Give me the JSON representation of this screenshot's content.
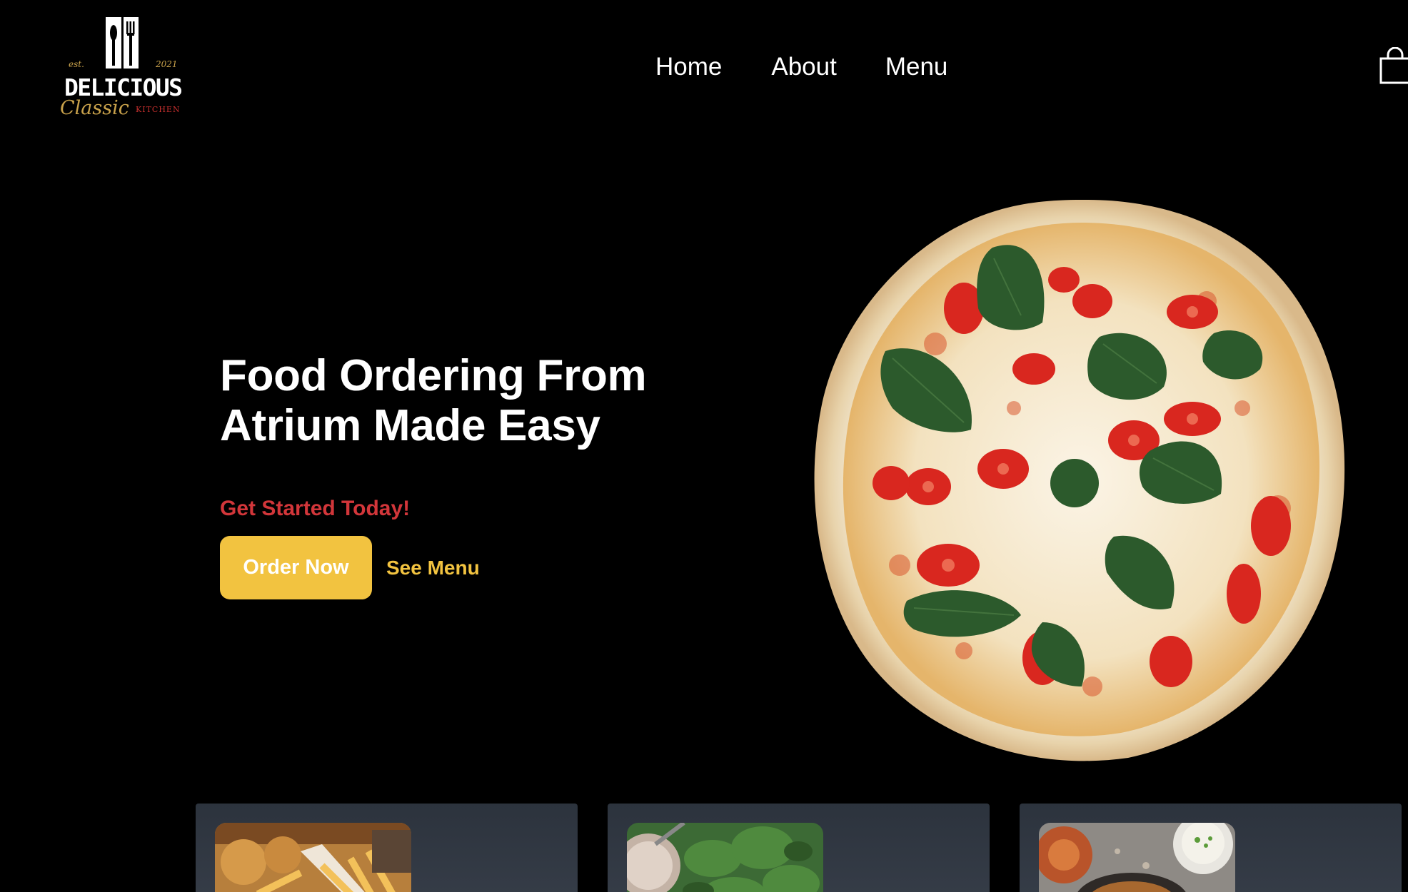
{
  "brand": {
    "est_label": "est.",
    "year": "2021",
    "name": "DELICIOUS",
    "script": "Classic",
    "kitchen": "KITCHEN",
    "colors": {
      "gold": "#c9a24b",
      "red": "#c8302e"
    }
  },
  "nav": {
    "items": [
      {
        "label": "Home"
      },
      {
        "label": "About"
      },
      {
        "label": "Menu"
      }
    ],
    "cart_icon": "shopping-bag-icon"
  },
  "hero": {
    "title_line1": "Food Ordering From",
    "title_line2": "Atrium Made Easy",
    "subtitle": "Get Started Today!",
    "primary_button": "Order Now",
    "secondary_link": "See Menu",
    "image": "margherita-pizza"
  },
  "cards": [
    {
      "image": "fried-food-and-fries"
    },
    {
      "image": "spinach-salad"
    },
    {
      "image": "sauce-and-fried-chicken"
    }
  ],
  "colors": {
    "background": "#000000",
    "accent_yellow": "#f2c340",
    "accent_red": "#d2363a",
    "card_bg": "#313842"
  }
}
